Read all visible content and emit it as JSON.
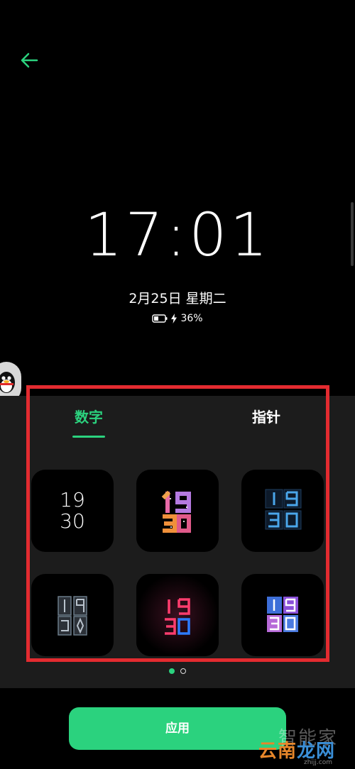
{
  "lockscreen": {
    "time": "17:01",
    "date": "2月25日 星期二",
    "battery_percent": "36%"
  },
  "tabs": [
    {
      "label": "数字",
      "active": true
    },
    {
      "label": "指针",
      "active": false
    }
  ],
  "faces": [
    {
      "style": "plain",
      "hour": "19",
      "minute": "30"
    },
    {
      "style": "colorful-blocks"
    },
    {
      "style": "blue-neon"
    },
    {
      "style": "gray-panels"
    },
    {
      "style": "red-blue-neon"
    },
    {
      "style": "color-tiles"
    }
  ],
  "pagination": {
    "current": 1,
    "total": 2
  },
  "apply_button": "应用",
  "watermark": {
    "top": "智能家",
    "brand_a": "云南",
    "brand_b": "龙网",
    "sub": "zhijj.com"
  },
  "colors": {
    "accent": "#2bd27e",
    "highlight": "#e32b30",
    "panel": "#1c1c1c"
  },
  "icons": [
    "back-arrow-icon",
    "battery-icon",
    "charging-bolt-icon",
    "qq-penguin-icon"
  ]
}
